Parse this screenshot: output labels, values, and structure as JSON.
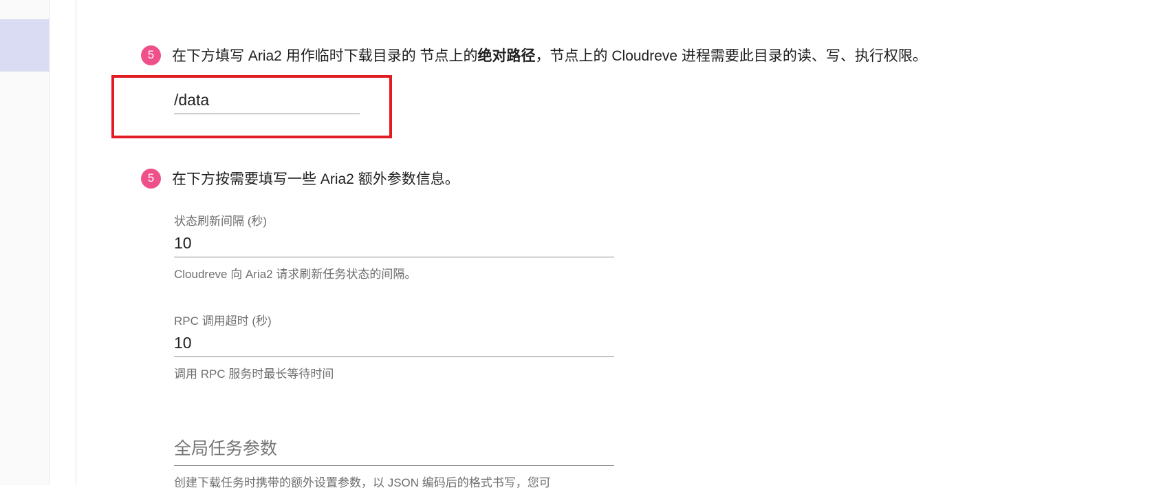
{
  "steps": [
    {
      "number": "5",
      "text_before": "在下方填写 Aria2 用作临时下载目录的 节点上的",
      "text_bold": "绝对路径",
      "text_after": "，节点上的 Cloudreve 进程需要此目录的读、写、执行权限。"
    },
    {
      "number": "5",
      "text": "在下方按需要填写一些 Aria2 额外参数信息。"
    }
  ],
  "temp_path": {
    "value": "/data"
  },
  "refresh_interval": {
    "label": "状态刷新间隔 (秒)",
    "value": "10",
    "helper": "Cloudreve 向 Aria2 请求刷新任务状态的间隔。"
  },
  "rpc_timeout": {
    "label": "RPC 调用超时 (秒)",
    "value": "10",
    "helper": "调用 RPC 服务时最长等待时间"
  },
  "global_params": {
    "placeholder": "全局任务参数",
    "helper": "创建下载任务时携带的额外设置参数，以 JSON 编码后的格式书写，您可"
  },
  "colors": {
    "badge": "#f0508a",
    "highlight": "#e21b23",
    "sidebar_selected": "#d9dcf2"
  }
}
